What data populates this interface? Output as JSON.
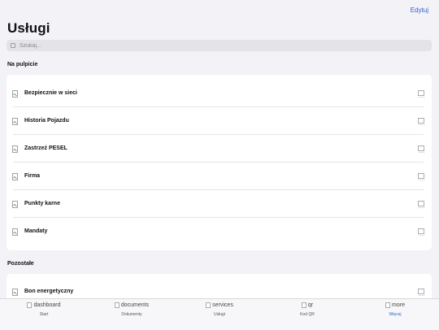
{
  "header": {
    "edit_label": "Edytuj",
    "title": "Usługi"
  },
  "search": {
    "placeholder": "Szukaj..."
  },
  "sections": {
    "desktop": {
      "header": "Na pulpicie",
      "items": [
        {
          "label": "Bezpiecznie w sieci"
        },
        {
          "label": "Historia Pojazdu"
        },
        {
          "label": "Zastrzeż PESEL"
        },
        {
          "label": "Firma"
        },
        {
          "label": "Punkty karne"
        },
        {
          "label": "Mandaty"
        }
      ]
    },
    "other": {
      "header": "Pozostałe",
      "items": [
        {
          "label": "Bon energetyczny"
        }
      ]
    }
  },
  "tabbar": {
    "tabs": [
      {
        "icon_alt": "dashboard",
        "label": "Start"
      },
      {
        "icon_alt": "documents",
        "label": "Dokumenty"
      },
      {
        "icon_alt": "services",
        "label": "Usługi"
      },
      {
        "icon_alt": "qr",
        "label": "Kod QR"
      },
      {
        "icon_alt": "more",
        "label": "Więcej"
      }
    ],
    "active_color": "#2f5fd0"
  }
}
